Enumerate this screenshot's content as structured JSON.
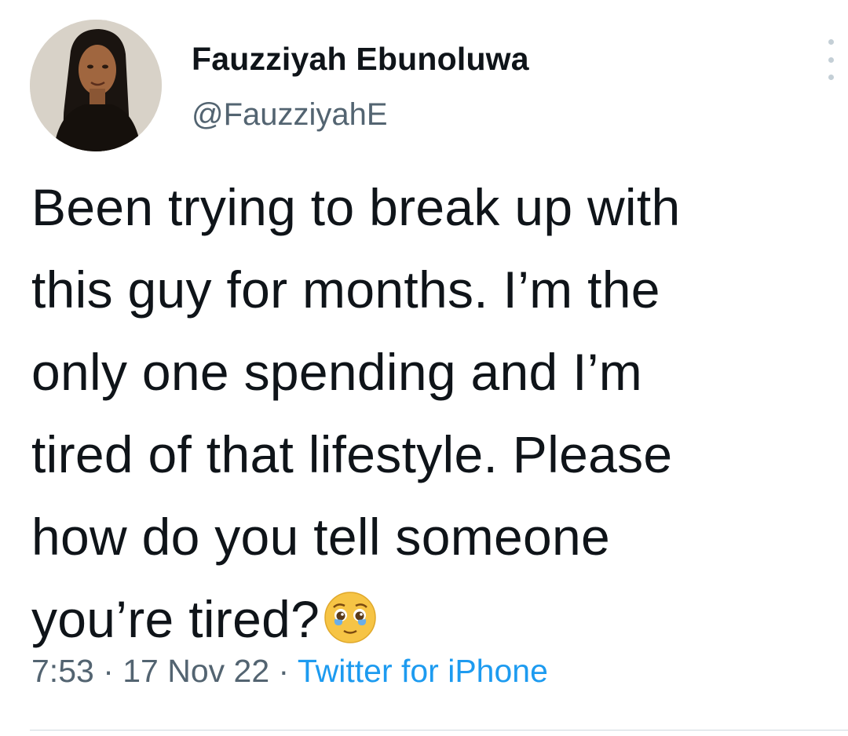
{
  "author": {
    "display_name": "Fauzziyah Ebunoluwa",
    "handle": "@FauzziyahE"
  },
  "tweet": {
    "lines": [
      "Been trying to break up with",
      "this guy for months. I’m the",
      "only one spending and I’m",
      "tired of that lifestyle. Please",
      "how do you tell someone",
      "you’re tired?"
    ],
    "emoji": "pleading-face-with-tears-emoji"
  },
  "meta": {
    "time": "7:53",
    "separator": " · ",
    "date": "17 Nov 22",
    "source": "Twitter for iPhone"
  },
  "icons": {
    "more": "more-options-icon"
  },
  "colors": {
    "text": "#0f1419",
    "secondary": "#536471",
    "link": "#1d9bf0",
    "divider": "#cfd9de"
  }
}
